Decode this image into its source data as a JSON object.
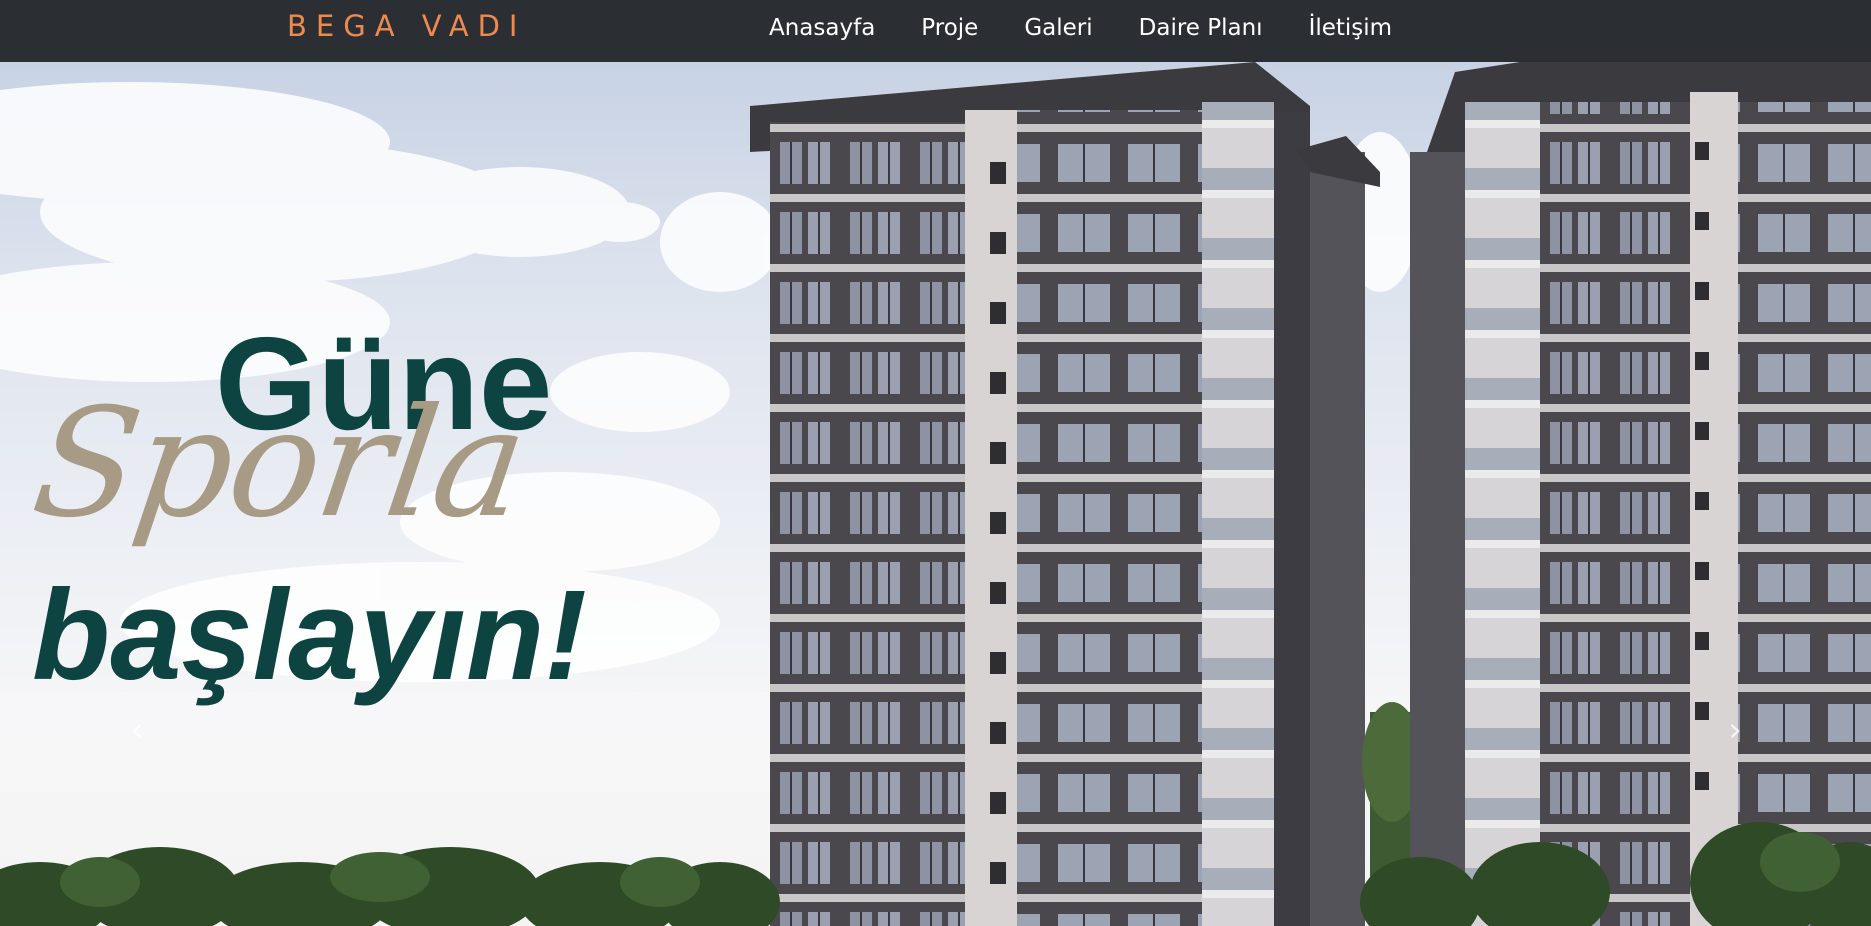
{
  "navbar": {
    "brand": "BEGA VADI",
    "links": [
      {
        "label": "Anasayfa"
      },
      {
        "label": "Proje"
      },
      {
        "label": "Galeri"
      },
      {
        "label": "Daire Planı"
      },
      {
        "label": "İletişim"
      }
    ]
  },
  "hero": {
    "headline_line1": "Güne",
    "headline_line2": "Sporla",
    "headline_line3": "başlayın!",
    "prev_icon": "chevron-left-icon",
    "next_icon": "chevron-right-icon"
  },
  "colors": {
    "navbar_bg": "#2b2f33",
    "brand": "#ed8a4f",
    "headline_green": "#0d4441",
    "headline_script": "#a79b85"
  }
}
